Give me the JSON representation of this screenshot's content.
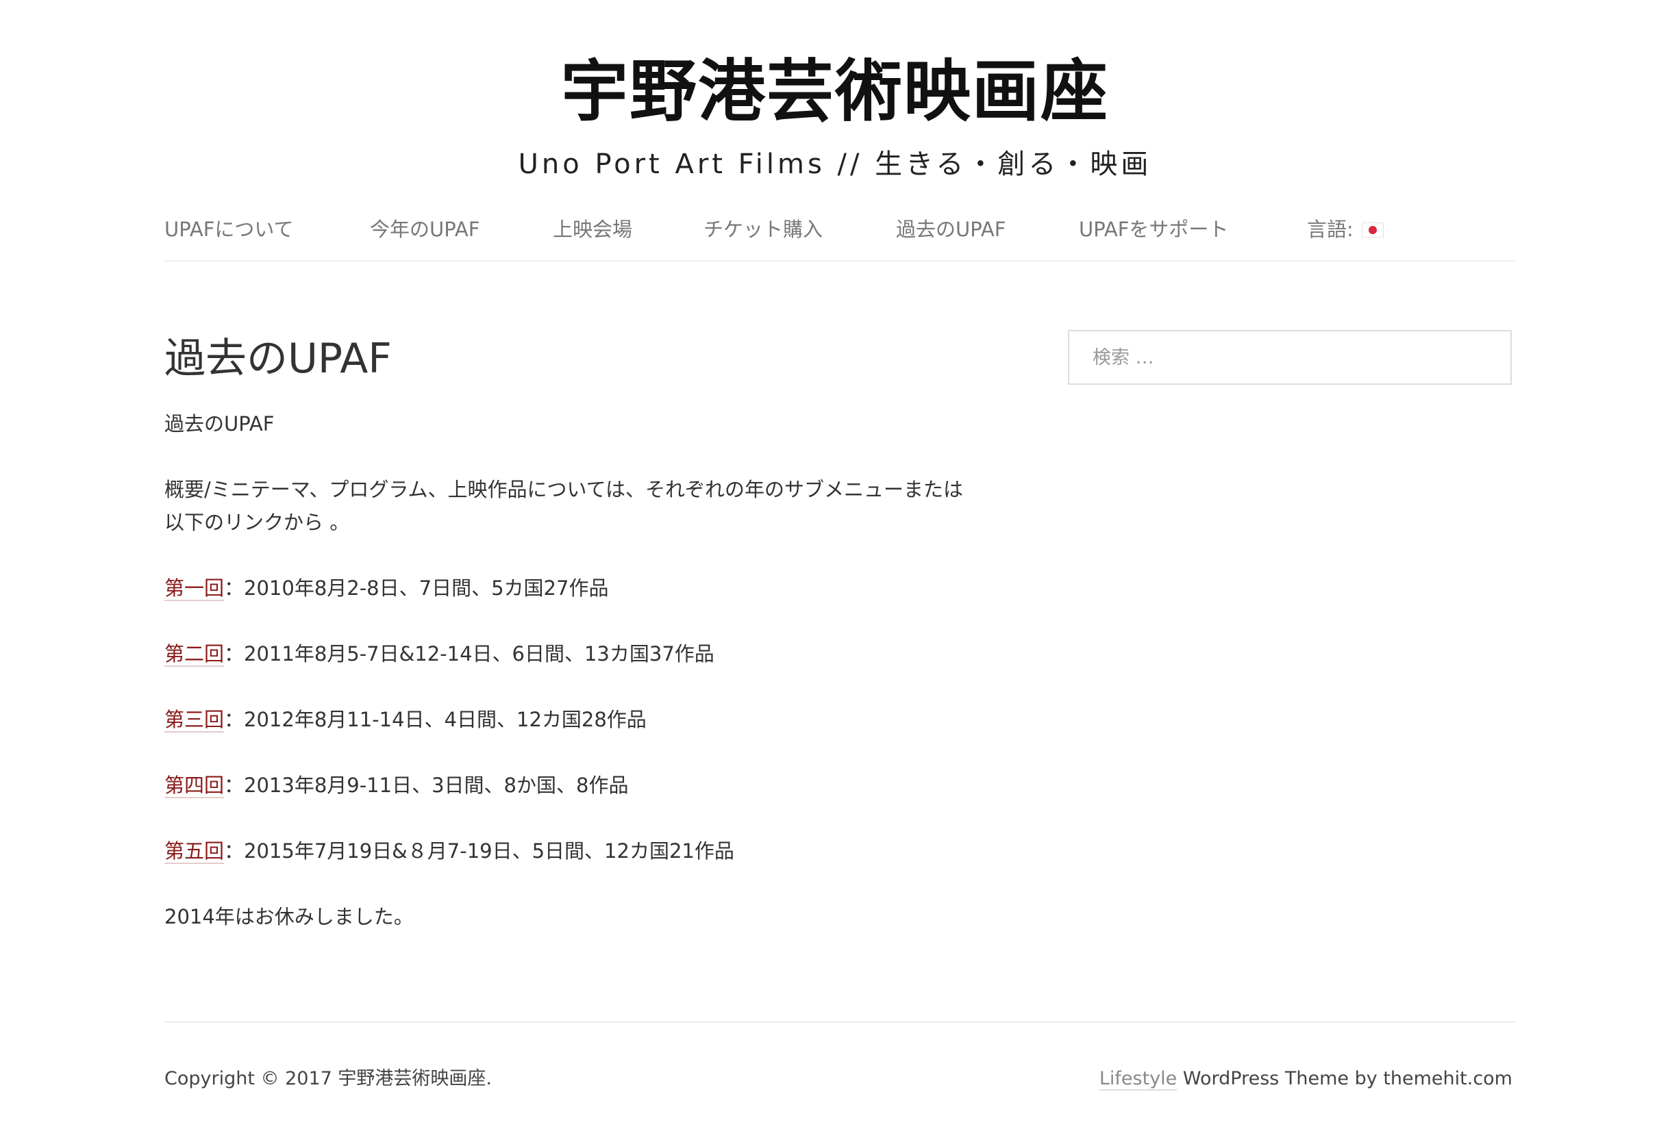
{
  "header": {
    "site_title": "宇野港芸術映画座",
    "tagline": "Uno Port Art Films // 生きる・創る・映画"
  },
  "nav": {
    "items": [
      "UPAFについて",
      "今年のUPAF",
      "上映会場",
      "チケット購入",
      "過去のUPAF",
      "UPAFをサポート",
      "言語:"
    ],
    "language_flag_icon": "japan-flag-icon"
  },
  "content": {
    "page_title": "過去のUPAF",
    "intro": "過去のUPAF",
    "description_line1": "概要/ミニテーマ、プログラム、上映作品については、それぞれの年のサブメニューまたは",
    "description_line2": "以下のリンクから 。",
    "festivals": [
      {
        "link": "第一回",
        "details": "：2010年8月2-8日、7日間、5カ国27作品"
      },
      {
        "link": "第二回",
        "details": "：2011年8月5-7日&12-14日、6日間、13カ国37作品"
      },
      {
        "link": "第三回",
        "details": "：2012年8月11-14日、4日間、12カ国28作品"
      },
      {
        "link": "第四回",
        "details": "：2013年8月9-11日、3日間、8か国、8作品"
      },
      {
        "link": "第五回",
        "details": "：2015年7月19日&８月7-19日、5日間、12カ国21作品"
      }
    ],
    "note": "2014年はお休みしました。"
  },
  "sidebar": {
    "search_placeholder": "検索 …"
  },
  "footer": {
    "copyright": "Copyright © 2017 宇野港芸術映画座.",
    "theme_link": "Lifestyle",
    "theme_credit": " WordPress Theme by themehit.com"
  },
  "colors": {
    "link": "#8b1a1a",
    "nav_text": "#777777",
    "body_text": "#333333",
    "divider": "#eeeeee"
  }
}
